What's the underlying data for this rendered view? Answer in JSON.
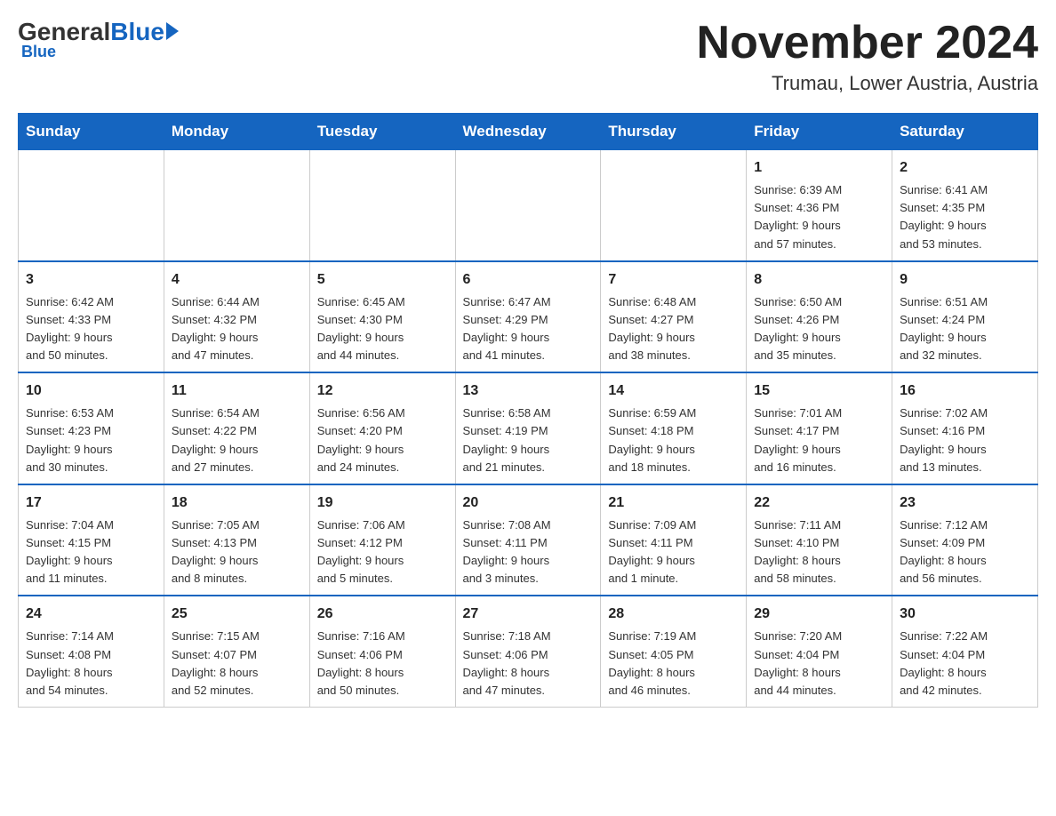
{
  "header": {
    "logo_general": "General",
    "logo_blue": "Blue",
    "calendar_title": "November 2024",
    "location": "Trumau, Lower Austria, Austria"
  },
  "weekdays": [
    "Sunday",
    "Monday",
    "Tuesday",
    "Wednesday",
    "Thursday",
    "Friday",
    "Saturday"
  ],
  "weeks": [
    [
      {
        "day": "",
        "info": ""
      },
      {
        "day": "",
        "info": ""
      },
      {
        "day": "",
        "info": ""
      },
      {
        "day": "",
        "info": ""
      },
      {
        "day": "",
        "info": ""
      },
      {
        "day": "1",
        "info": "Sunrise: 6:39 AM\nSunset: 4:36 PM\nDaylight: 9 hours\nand 57 minutes."
      },
      {
        "day": "2",
        "info": "Sunrise: 6:41 AM\nSunset: 4:35 PM\nDaylight: 9 hours\nand 53 minutes."
      }
    ],
    [
      {
        "day": "3",
        "info": "Sunrise: 6:42 AM\nSunset: 4:33 PM\nDaylight: 9 hours\nand 50 minutes."
      },
      {
        "day": "4",
        "info": "Sunrise: 6:44 AM\nSunset: 4:32 PM\nDaylight: 9 hours\nand 47 minutes."
      },
      {
        "day": "5",
        "info": "Sunrise: 6:45 AM\nSunset: 4:30 PM\nDaylight: 9 hours\nand 44 minutes."
      },
      {
        "day": "6",
        "info": "Sunrise: 6:47 AM\nSunset: 4:29 PM\nDaylight: 9 hours\nand 41 minutes."
      },
      {
        "day": "7",
        "info": "Sunrise: 6:48 AM\nSunset: 4:27 PM\nDaylight: 9 hours\nand 38 minutes."
      },
      {
        "day": "8",
        "info": "Sunrise: 6:50 AM\nSunset: 4:26 PM\nDaylight: 9 hours\nand 35 minutes."
      },
      {
        "day": "9",
        "info": "Sunrise: 6:51 AM\nSunset: 4:24 PM\nDaylight: 9 hours\nand 32 minutes."
      }
    ],
    [
      {
        "day": "10",
        "info": "Sunrise: 6:53 AM\nSunset: 4:23 PM\nDaylight: 9 hours\nand 30 minutes."
      },
      {
        "day": "11",
        "info": "Sunrise: 6:54 AM\nSunset: 4:22 PM\nDaylight: 9 hours\nand 27 minutes."
      },
      {
        "day": "12",
        "info": "Sunrise: 6:56 AM\nSunset: 4:20 PM\nDaylight: 9 hours\nand 24 minutes."
      },
      {
        "day": "13",
        "info": "Sunrise: 6:58 AM\nSunset: 4:19 PM\nDaylight: 9 hours\nand 21 minutes."
      },
      {
        "day": "14",
        "info": "Sunrise: 6:59 AM\nSunset: 4:18 PM\nDaylight: 9 hours\nand 18 minutes."
      },
      {
        "day": "15",
        "info": "Sunrise: 7:01 AM\nSunset: 4:17 PM\nDaylight: 9 hours\nand 16 minutes."
      },
      {
        "day": "16",
        "info": "Sunrise: 7:02 AM\nSunset: 4:16 PM\nDaylight: 9 hours\nand 13 minutes."
      }
    ],
    [
      {
        "day": "17",
        "info": "Sunrise: 7:04 AM\nSunset: 4:15 PM\nDaylight: 9 hours\nand 11 minutes."
      },
      {
        "day": "18",
        "info": "Sunrise: 7:05 AM\nSunset: 4:13 PM\nDaylight: 9 hours\nand 8 minutes."
      },
      {
        "day": "19",
        "info": "Sunrise: 7:06 AM\nSunset: 4:12 PM\nDaylight: 9 hours\nand 5 minutes."
      },
      {
        "day": "20",
        "info": "Sunrise: 7:08 AM\nSunset: 4:11 PM\nDaylight: 9 hours\nand 3 minutes."
      },
      {
        "day": "21",
        "info": "Sunrise: 7:09 AM\nSunset: 4:11 PM\nDaylight: 9 hours\nand 1 minute."
      },
      {
        "day": "22",
        "info": "Sunrise: 7:11 AM\nSunset: 4:10 PM\nDaylight: 8 hours\nand 58 minutes."
      },
      {
        "day": "23",
        "info": "Sunrise: 7:12 AM\nSunset: 4:09 PM\nDaylight: 8 hours\nand 56 minutes."
      }
    ],
    [
      {
        "day": "24",
        "info": "Sunrise: 7:14 AM\nSunset: 4:08 PM\nDaylight: 8 hours\nand 54 minutes."
      },
      {
        "day": "25",
        "info": "Sunrise: 7:15 AM\nSunset: 4:07 PM\nDaylight: 8 hours\nand 52 minutes."
      },
      {
        "day": "26",
        "info": "Sunrise: 7:16 AM\nSunset: 4:06 PM\nDaylight: 8 hours\nand 50 minutes."
      },
      {
        "day": "27",
        "info": "Sunrise: 7:18 AM\nSunset: 4:06 PM\nDaylight: 8 hours\nand 47 minutes."
      },
      {
        "day": "28",
        "info": "Sunrise: 7:19 AM\nSunset: 4:05 PM\nDaylight: 8 hours\nand 46 minutes."
      },
      {
        "day": "29",
        "info": "Sunrise: 7:20 AM\nSunset: 4:04 PM\nDaylight: 8 hours\nand 44 minutes."
      },
      {
        "day": "30",
        "info": "Sunrise: 7:22 AM\nSunset: 4:04 PM\nDaylight: 8 hours\nand 42 minutes."
      }
    ]
  ]
}
